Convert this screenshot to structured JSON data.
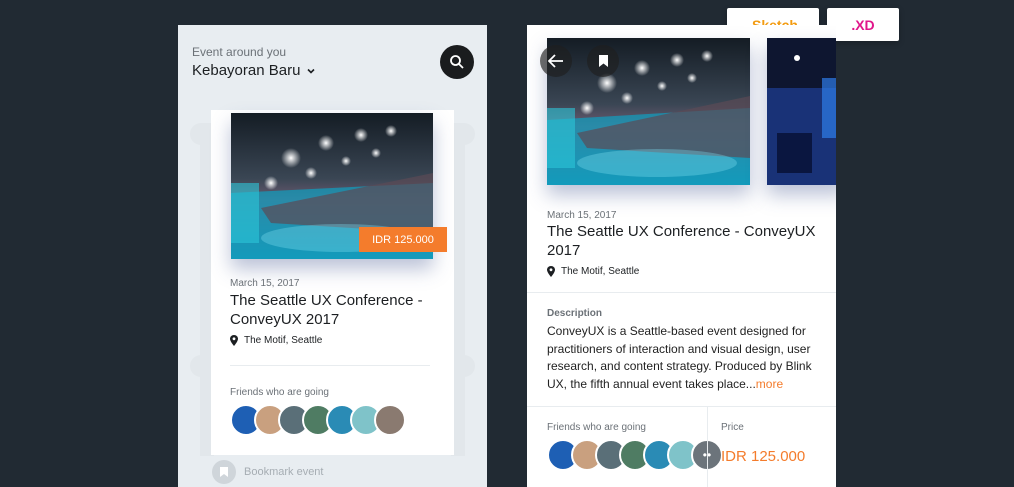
{
  "badges": {
    "sketch": ".Sketch",
    "xd": ".XD"
  },
  "list_screen": {
    "subtitle": "Event around you",
    "location": "Kebayoran Baru",
    "card": {
      "price": "IDR 125.000",
      "date": "March 15, 2017",
      "title": "The Seattle UX Conference - ConveyUX 2017",
      "venue": "The Motif, Seattle",
      "friends_label": "Friends who are going"
    },
    "bookmark_label": "Bookmark event"
  },
  "detail_screen": {
    "date": "March 15, 2017",
    "title": "The Seattle UX Conference - ConveyUX 2017",
    "venue": "The Motif, Seattle",
    "description_label": "Description",
    "description_text": "ConveyUX is a Seattle-based event designed for practitioners of interaction and visual design, user research, and content strategy. Produced by Blink UX, the fifth annual event takes place...",
    "more_link": "more",
    "friends_label": "Friends who are going",
    "more_friends": "••",
    "price_label": "Price",
    "price_value": "IDR 125.000"
  },
  "colors": {
    "background": "#212a33",
    "accent_orange": "#f47c2c",
    "sketch_orange": "#f39c12",
    "xd_pink": "#e0168b"
  },
  "icons": [
    "search-icon",
    "chevron-down-icon",
    "location-pin-icon",
    "bookmark-icon",
    "back-arrow-icon"
  ]
}
